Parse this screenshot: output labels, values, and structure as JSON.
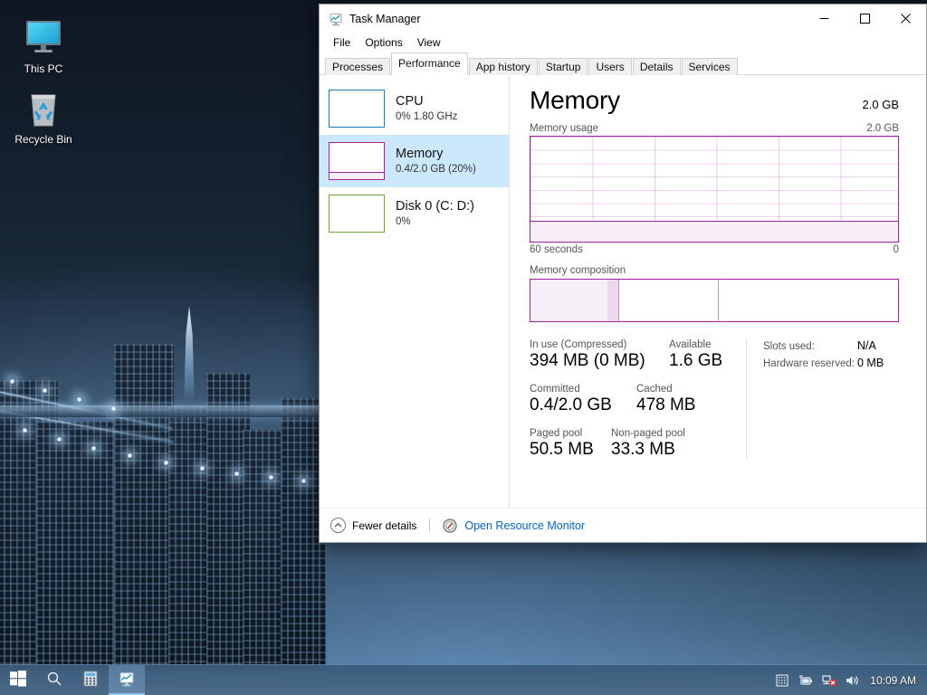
{
  "desktop": {
    "icons": [
      {
        "label": "This PC",
        "icon": "this-pc-icon"
      },
      {
        "label": "Recycle Bin",
        "icon": "recycle-bin-icon"
      }
    ]
  },
  "window": {
    "title": "Task Manager",
    "app_icon": "task-manager-icon",
    "controls": {
      "minimize": "–",
      "maximize": "□",
      "close": "✕"
    },
    "menu": [
      "File",
      "Options",
      "View"
    ],
    "tabs": [
      {
        "label": "Processes",
        "active": false
      },
      {
        "label": "Performance",
        "active": true
      },
      {
        "label": "App history",
        "active": false
      },
      {
        "label": "Startup",
        "active": false
      },
      {
        "label": "Users",
        "active": false
      },
      {
        "label": "Details",
        "active": false
      },
      {
        "label": "Services",
        "active": false
      }
    ]
  },
  "sidebar": {
    "items": [
      {
        "name": "CPU",
        "sub": "0%  1.80 GHz",
        "color": "#1a7bb9",
        "fill_pct": 0,
        "selected": false
      },
      {
        "name": "Memory",
        "sub": "0.4/2.0 GB (20%)",
        "color": "#a21ea2",
        "fill_pct": 20,
        "selected": true
      },
      {
        "name": "Disk 0 (C: D:)",
        "sub": "0%",
        "color": "#6aa832",
        "fill_pct": 0,
        "selected": false
      }
    ]
  },
  "detail": {
    "title": "Memory",
    "capacity": "2.0 GB",
    "graph": {
      "label": "Memory usage",
      "max_label": "2.0 GB",
      "x_left": "60 seconds",
      "x_right": "0",
      "usage_pct": 20,
      "accent": "#a21ea2"
    },
    "composition": {
      "label": "Memory composition",
      "segments": [
        {
          "name": "in-use",
          "pct": 21,
          "color": "#f7eff7"
        },
        {
          "name": "modified",
          "pct": 3,
          "color": "#ecd9ec"
        },
        {
          "name": "standby",
          "pct": 27,
          "color": "#ffffff"
        },
        {
          "name": "free",
          "pct": 49,
          "color": "#ffffff"
        }
      ]
    },
    "stats": {
      "in_use_label": "In use (Compressed)",
      "in_use_value": "394 MB (0 MB)",
      "available_label": "Available",
      "available_value": "1.6 GB",
      "committed_label": "Committed",
      "committed_value": "0.4/2.0 GB",
      "cached_label": "Cached",
      "cached_value": "478 MB",
      "paged_label": "Paged pool",
      "paged_value": "50.5 MB",
      "nonpaged_label": "Non-paged pool",
      "nonpaged_value": "33.3 MB",
      "slots_label": "Slots used:",
      "slots_value": "N/A",
      "hardware_label": "Hardware reserved:",
      "hardware_value": "0 MB"
    }
  },
  "footer": {
    "fewer_details": "Fewer details",
    "resource_monitor": "Open Resource Monitor"
  },
  "taskbar": {
    "buttons": [
      {
        "name": "start-button",
        "icon": "windows-logo-icon"
      },
      {
        "name": "search-button",
        "icon": "search-icon"
      },
      {
        "name": "calculator-button",
        "icon": "calculator-icon"
      },
      {
        "name": "taskmanager-button",
        "icon": "task-manager-icon"
      }
    ],
    "tray": [
      {
        "name": "show-hidden-icons",
        "icon": "chevron-up-icon"
      },
      {
        "name": "power-icon",
        "icon": "battery-icon"
      },
      {
        "name": "network-icon",
        "icon": "network-disconnected-icon"
      },
      {
        "name": "volume-icon",
        "icon": "speaker-icon"
      }
    ],
    "clock": "10:09 AM"
  }
}
